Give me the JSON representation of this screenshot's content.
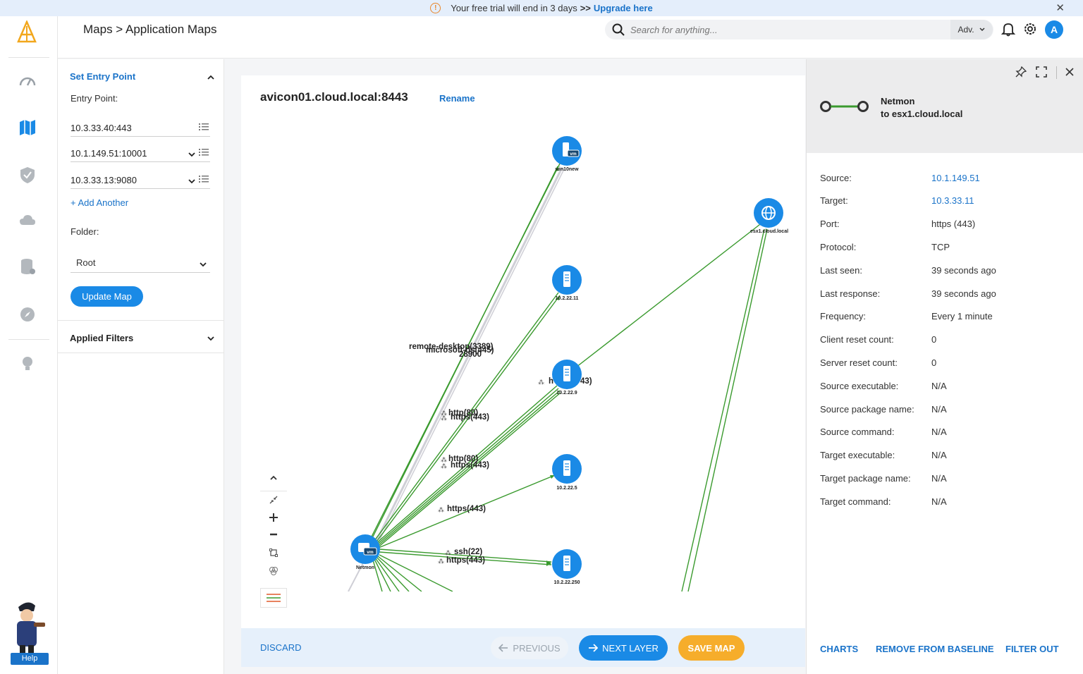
{
  "banner": {
    "message": "Your free trial will end in 3 days",
    "chevrons": ">>",
    "upgrade_label": "Upgrade here"
  },
  "header": {
    "breadcrumb": "Maps > Application Maps",
    "search_placeholder": "Search for anything...",
    "adv_label": "Adv.",
    "avatar_initial": "A"
  },
  "rail": {
    "help_label": "Help",
    "items": [
      "speed-icon",
      "map-icon",
      "shield-icon",
      "cloud-icon",
      "database-icon",
      "compass-icon",
      "lightbulb-icon"
    ]
  },
  "sidebar": {
    "entry_section_title": "Set Entry Point",
    "entry_point_label": "Entry Point:",
    "entry_points": [
      "10.3.33.40:443",
      "10.1.149.51:10001",
      "10.3.33.13:9080"
    ],
    "add_another": "+ Add Another",
    "folder_label": "Folder:",
    "folder_value": "Root",
    "update_button": "Update Map",
    "filters_title": "Applied Filters"
  },
  "map": {
    "title": "avicon01.cloud.local:8443",
    "rename_label": "Rename",
    "nodes": [
      {
        "id": "win10new",
        "label": "win10new",
        "badge": "vm"
      },
      {
        "id": "n10.2.22.11",
        "label": "10.2.22.11"
      },
      {
        "id": "n10.2.22.9",
        "label": "10.2.22.9"
      },
      {
        "id": "n10.2.22.5",
        "label": "10.2.22.5"
      },
      {
        "id": "n10.2.22.250",
        "label": "10.2.22.250"
      },
      {
        "id": "esx1",
        "label": "esx1.cloud.local"
      },
      {
        "id": "netmon",
        "label": "Netmon",
        "badge": "vm"
      }
    ],
    "edge_labels": {
      "rdp": "remote-desktop(3389)",
      "ms": "microsoft-ds(445)",
      "p28900": "28900",
      "http1": "http(80)",
      "https1": "https(443)",
      "http2": "http(80)",
      "https2": "https(443)",
      "https3": "https(443)",
      "ssh": "ssh(22)",
      "https4": "https(443)",
      "h9": "h",
      "t9": "43)"
    }
  },
  "footer": {
    "discard": "DISCARD",
    "previous": "PREVIOUS",
    "next_layer": "NEXT LAYER",
    "save_map": "SAVE MAP"
  },
  "details": {
    "connection_from": "Netmon",
    "connection_to": "to esx1.cloud.local",
    "properties": [
      {
        "key": "Source:",
        "value": "10.1.149.51",
        "link": true
      },
      {
        "key": "Target:",
        "value": "10.3.33.11",
        "link": true
      },
      {
        "key": "Port:",
        "value": "https (443)",
        "link": false
      },
      {
        "key": "Protocol:",
        "value": "TCP",
        "link": false
      },
      {
        "key": "Last seen:",
        "value": "39 seconds ago",
        "link": false
      },
      {
        "key": "Last response:",
        "value": "39 seconds ago",
        "link": false
      },
      {
        "key": "Frequency:",
        "value": "Every 1 minute",
        "link": false
      },
      {
        "key": "Client reset count:",
        "value": "0",
        "link": false
      },
      {
        "key": "Server reset count:",
        "value": "0",
        "link": false
      },
      {
        "key": "Source executable:",
        "value": "N/A",
        "link": false
      },
      {
        "key": "Source package name:",
        "value": "N/A",
        "link": false
      },
      {
        "key": "Source command:",
        "value": "N/A",
        "link": false
      },
      {
        "key": "Target executable:",
        "value": "N/A",
        "link": false
      },
      {
        "key": "Target package name:",
        "value": "N/A",
        "link": false
      },
      {
        "key": "Target command:",
        "value": "N/A",
        "link": false
      }
    ],
    "charts_label": "CHARTS",
    "remove_label": "REMOVE FROM BASELINE",
    "filter_label": "FILTER OUT"
  },
  "colors": {
    "accent": "#1a8ae6",
    "link": "#1a73c9",
    "edge": "#3a9a2e",
    "save": "#f6ad2b"
  }
}
